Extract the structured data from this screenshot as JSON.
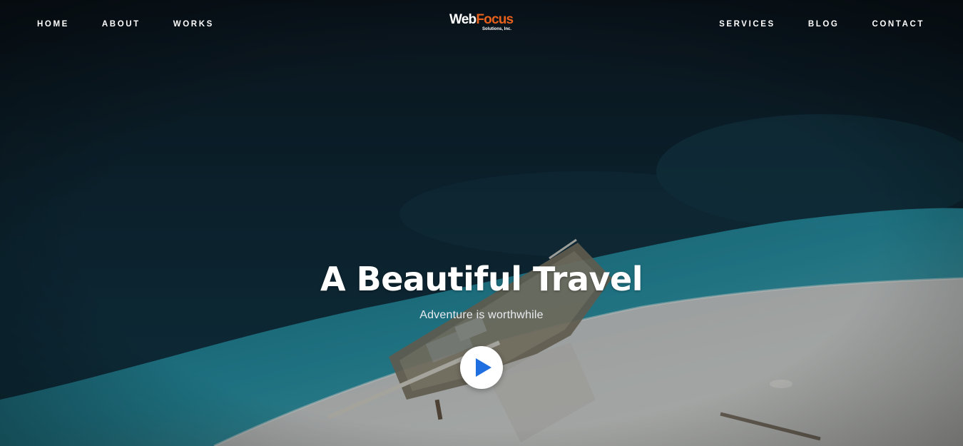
{
  "nav": {
    "left": [
      {
        "label": "HOME"
      },
      {
        "label": "ABOUT"
      },
      {
        "label": "WORKS"
      }
    ],
    "right": [
      {
        "label": "SERVICES"
      },
      {
        "label": "BLOG"
      },
      {
        "label": "CONTACT"
      }
    ]
  },
  "logo": {
    "word_primary": "Web",
    "word_accent": "Focus",
    "tagline": "Solutions, Inc.",
    "accent_color": "#e8611c"
  },
  "hero": {
    "title": "A Beautiful Travel",
    "subtitle": "Adventure is worthwhile",
    "play_icon": "play-icon",
    "play_color": "#1f6fe0"
  }
}
